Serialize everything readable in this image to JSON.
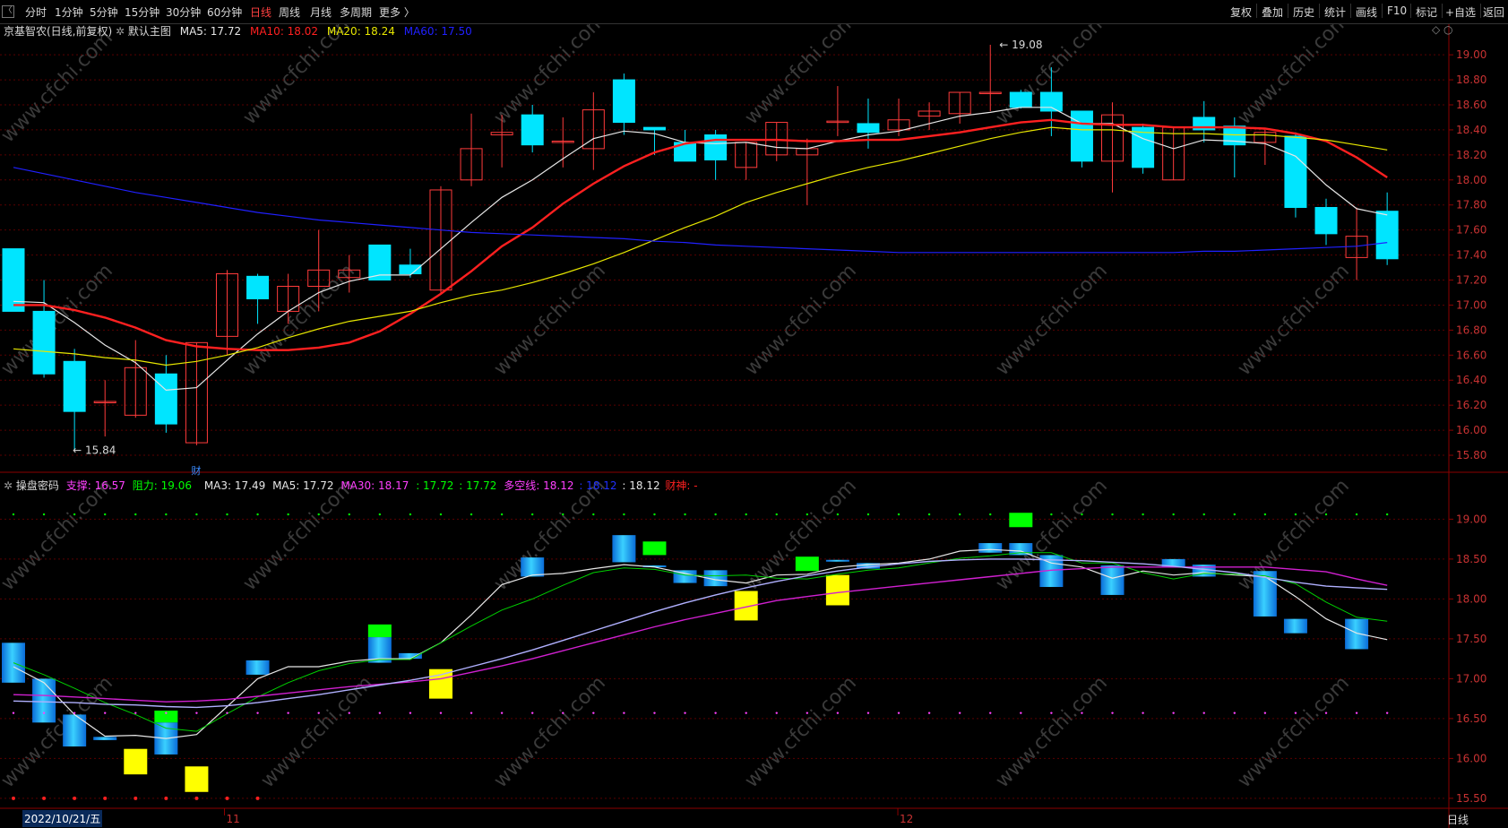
{
  "toolbar": {
    "timeframes": [
      "分时",
      "1分钟",
      "5分钟",
      "15分钟",
      "30分钟",
      "60分钟",
      "日线",
      "周线",
      "月线",
      "多周期",
      "更多 〉"
    ],
    "active": "日线",
    "right_buttons": [
      "复权",
      "叠加",
      "历史",
      "统计",
      "画线",
      "F10",
      "标记",
      "+自选",
      "返回"
    ]
  },
  "main_legend": {
    "stock": "京基智农(日线,前复权)",
    "template": "默认主图",
    "ma5": "MA5: 17.72",
    "ma10": "MA10: 18.02",
    "ma20": "MA20: 18.24",
    "ma60": "MA60: 17.50"
  },
  "sub_legend": {
    "name": "操盘密码",
    "support": "支撑: 16.57",
    "resist": "阻力: 19.06",
    "ma3": "MA3: 17.49",
    "ma5": "MA5: 17.72",
    "ma30": "MA30: 18.17",
    "v1": ": 17.72",
    "v2": ": 17.72",
    "dk": "多空线: 18.12",
    "v3": ": 18.12",
    "v4": ": 18.12",
    "caishen": "财神: -"
  },
  "annotations": {
    "high": "19.08",
    "low": "15.84",
    "fin_marker": "财"
  },
  "date_tag": "2022/10/21/五",
  "bottom_label": "日线",
  "watermark": "www.cfchi.com",
  "colors": {
    "up": "#ff3b3b",
    "down": "#00e5ff",
    "ma5": "#e6e6e6",
    "ma10": "#ff2020",
    "ma20": "#e6e600",
    "ma60": "#2020ff",
    "dk": "#c000c0",
    "green": "#00ff00",
    "yellow": "#ffff00"
  },
  "chart_data": [
    {
      "type": "candlestick",
      "title": "京基智农(日线,前复权)",
      "y_ticks": [
        15.8,
        16.0,
        16.2,
        16.4,
        16.6,
        16.8,
        17.0,
        17.2,
        17.4,
        17.6,
        17.8,
        18.0,
        18.2,
        18.4,
        18.6,
        18.8,
        19.0
      ],
      "ylim": [
        15.7,
        19.18
      ],
      "x_labels": [
        "11",
        "12"
      ],
      "candles": [
        {
          "o": 17.45,
          "h": 17.45,
          "l": 16.95,
          "c": 16.95
        },
        {
          "o": 16.95,
          "h": 17.2,
          "l": 16.42,
          "c": 16.45
        },
        {
          "o": 16.55,
          "h": 16.65,
          "l": 15.84,
          "c": 16.15
        },
        {
          "o": 16.23,
          "h": 16.4,
          "l": 15.95,
          "c": 16.23
        },
        {
          "o": 16.12,
          "h": 16.72,
          "l": 16.1,
          "c": 16.5
        },
        {
          "o": 16.45,
          "h": 16.6,
          "l": 15.98,
          "c": 16.05
        },
        {
          "o": 15.9,
          "h": 16.7,
          "l": 15.88,
          "c": 16.7
        },
        {
          "o": 16.75,
          "h": 17.28,
          "l": 16.6,
          "c": 17.25
        },
        {
          "o": 17.23,
          "h": 17.25,
          "l": 16.85,
          "c": 17.05
        },
        {
          "o": 16.95,
          "h": 17.25,
          "l": 16.85,
          "c": 17.15
        },
        {
          "o": 17.15,
          "h": 17.6,
          "l": 16.95,
          "c": 17.28
        },
        {
          "o": 17.22,
          "h": 17.4,
          "l": 17.1,
          "c": 17.28
        },
        {
          "o": 17.48,
          "h": 17.48,
          "l": 17.2,
          "c": 17.2
        },
        {
          "o": 17.32,
          "h": 17.45,
          "l": 17.22,
          "c": 17.25
        },
        {
          "o": 17.12,
          "h": 17.95,
          "l": 17.1,
          "c": 17.92
        },
        {
          "o": 18.0,
          "h": 18.53,
          "l": 17.95,
          "c": 18.25
        },
        {
          "o": 18.36,
          "h": 18.52,
          "l": 18.1,
          "c": 18.38
        },
        {
          "o": 18.52,
          "h": 18.6,
          "l": 18.22,
          "c": 18.28
        },
        {
          "o": 18.31,
          "h": 18.5,
          "l": 18.1,
          "c": 18.31
        },
        {
          "o": 18.25,
          "h": 18.7,
          "l": 18.08,
          "c": 18.56
        },
        {
          "o": 18.8,
          "h": 18.85,
          "l": 18.36,
          "c": 18.46
        },
        {
          "o": 18.42,
          "h": 18.42,
          "l": 18.2,
          "c": 18.4
        },
        {
          "o": 18.3,
          "h": 18.4,
          "l": 18.15,
          "c": 18.15
        },
        {
          "o": 18.36,
          "h": 18.4,
          "l": 18.0,
          "c": 18.16
        },
        {
          "o": 18.1,
          "h": 18.3,
          "l": 18.0,
          "c": 18.3
        },
        {
          "o": 18.2,
          "h": 18.46,
          "l": 18.15,
          "c": 18.46
        },
        {
          "o": 18.2,
          "h": 18.33,
          "l": 17.8,
          "c": 18.25
        },
        {
          "o": 18.47,
          "h": 18.75,
          "l": 18.35,
          "c": 18.47
        },
        {
          "o": 18.45,
          "h": 18.65,
          "l": 18.25,
          "c": 18.38
        },
        {
          "o": 18.4,
          "h": 18.65,
          "l": 18.35,
          "c": 18.48
        },
        {
          "o": 18.51,
          "h": 18.62,
          "l": 18.4,
          "c": 18.55
        },
        {
          "o": 18.53,
          "h": 18.7,
          "l": 18.45,
          "c": 18.7
        },
        {
          "o": 18.7,
          "h": 19.08,
          "l": 18.55,
          "c": 18.7
        },
        {
          "o": 18.7,
          "h": 18.72,
          "l": 18.57,
          "c": 18.58
        },
        {
          "o": 18.7,
          "h": 18.9,
          "l": 18.35,
          "c": 18.55
        },
        {
          "o": 18.55,
          "h": 18.55,
          "l": 18.1,
          "c": 18.15
        },
        {
          "o": 18.15,
          "h": 18.62,
          "l": 17.9,
          "c": 18.52
        },
        {
          "o": 18.42,
          "h": 18.45,
          "l": 18.05,
          "c": 18.1
        },
        {
          "o": 18.0,
          "h": 18.42,
          "l": 18.0,
          "c": 18.42
        },
        {
          "o": 18.5,
          "h": 18.63,
          "l": 18.3,
          "c": 18.4
        },
        {
          "o": 18.43,
          "h": 18.5,
          "l": 18.02,
          "c": 18.28
        },
        {
          "o": 18.3,
          "h": 18.4,
          "l": 18.12,
          "c": 18.38
        },
        {
          "o": 18.35,
          "h": 18.38,
          "l": 17.7,
          "c": 17.78
        },
        {
          "o": 17.78,
          "h": 17.85,
          "l": 17.48,
          "c": 17.57
        },
        {
          "o": 17.38,
          "h": 17.78,
          "l": 17.2,
          "c": 17.55
        },
        {
          "o": 17.75,
          "h": 17.9,
          "l": 17.32,
          "c": 17.37
        }
      ],
      "series": [
        {
          "name": "MA5",
          "values": [
            17.03,
            17.02,
            16.86,
            16.68,
            16.54,
            16.32,
            16.34,
            16.56,
            16.77,
            16.95,
            17.1,
            17.19,
            17.24,
            17.24,
            17.45,
            17.66,
            17.86,
            18.0,
            18.17,
            18.33,
            18.39,
            18.37,
            18.3,
            18.29,
            18.3,
            18.26,
            18.25,
            18.31,
            18.36,
            18.39,
            18.45,
            18.51,
            18.54,
            18.58,
            18.58,
            18.45,
            18.45,
            18.33,
            18.25,
            18.32,
            18.31,
            18.29,
            18.19,
            17.96,
            17.77,
            17.72
          ]
        },
        {
          "name": "MA10",
          "values": [
            17.0,
            17.0,
            16.96,
            16.9,
            16.82,
            16.72,
            16.67,
            16.65,
            16.64,
            16.64,
            16.66,
            16.7,
            16.79,
            16.93,
            17.09,
            17.27,
            17.47,
            17.62,
            17.81,
            17.97,
            18.11,
            18.22,
            18.29,
            18.32,
            18.32,
            18.32,
            18.31,
            18.31,
            18.32,
            18.32,
            18.35,
            18.38,
            18.42,
            18.46,
            18.48,
            18.45,
            18.44,
            18.44,
            18.42,
            18.42,
            18.42,
            18.41,
            18.37,
            18.31,
            18.18,
            18.02
          ]
        },
        {
          "name": "MA20",
          "values": [
            16.65,
            16.63,
            16.61,
            16.58,
            16.56,
            16.52,
            16.55,
            16.6,
            16.66,
            16.74,
            16.81,
            16.87,
            16.91,
            16.95,
            17.02,
            17.08,
            17.12,
            17.18,
            17.25,
            17.33,
            17.42,
            17.52,
            17.62,
            17.71,
            17.82,
            17.9,
            17.97,
            18.04,
            18.1,
            18.15,
            18.21,
            18.27,
            18.33,
            18.38,
            18.42,
            18.4,
            18.4,
            18.38,
            18.37,
            18.37,
            18.36,
            18.36,
            18.34,
            18.32,
            18.28,
            18.24
          ]
        },
        {
          "name": "MA60",
          "values": [
            18.1,
            18.05,
            18.0,
            17.95,
            17.9,
            17.86,
            17.82,
            17.78,
            17.74,
            17.71,
            17.68,
            17.66,
            17.64,
            17.62,
            17.6,
            17.58,
            17.57,
            17.56,
            17.55,
            17.54,
            17.53,
            17.51,
            17.5,
            17.48,
            17.47,
            17.46,
            17.45,
            17.44,
            17.43,
            17.42,
            17.42,
            17.42,
            17.42,
            17.42,
            17.42,
            17.42,
            17.42,
            17.42,
            17.42,
            17.43,
            17.43,
            17.44,
            17.45,
            17.46,
            17.47,
            17.5
          ]
        }
      ]
    },
    {
      "type": "bar",
      "title": "操盘密码",
      "y_ticks": [
        15.5,
        16.0,
        16.5,
        17.0,
        17.5,
        18.0,
        18.5,
        19.0
      ],
      "ylim": [
        15.42,
        19.33
      ],
      "blocks": [
        {
          "i": 0,
          "top": 17.45,
          "bot": 16.95,
          "c": "blue"
        },
        {
          "i": 1,
          "top": 17.0,
          "bot": 16.45,
          "c": "blue"
        },
        {
          "i": 2,
          "top": 16.55,
          "bot": 16.15,
          "c": "blue"
        },
        {
          "i": 3,
          "top": 16.27,
          "bot": 16.23,
          "c": "blue"
        },
        {
          "i": 4,
          "top": 16.12,
          "bot": 15.8,
          "c": "yellow"
        },
        {
          "i": 5,
          "top": 16.6,
          "bot": 16.45,
          "c": "green"
        },
        {
          "i": 5,
          "top": 16.45,
          "bot": 16.05,
          "c": "blue"
        },
        {
          "i": 6,
          "top": 15.9,
          "bot": 15.58,
          "c": "yellow"
        },
        {
          "i": 8,
          "top": 17.23,
          "bot": 17.05,
          "c": "blue"
        },
        {
          "i": 12,
          "top": 17.68,
          "bot": 17.52,
          "c": "green"
        },
        {
          "i": 12,
          "top": 17.52,
          "bot": 17.2,
          "c": "blue"
        },
        {
          "i": 13,
          "top": 17.32,
          "bot": 17.25,
          "c": "blue"
        },
        {
          "i": 14,
          "top": 17.12,
          "bot": 16.75,
          "c": "yellow"
        },
        {
          "i": 17,
          "top": 18.52,
          "bot": 18.28,
          "c": "blue"
        },
        {
          "i": 20,
          "top": 18.8,
          "bot": 18.46,
          "c": "blue"
        },
        {
          "i": 21,
          "top": 18.72,
          "bot": 18.55,
          "c": "green"
        },
        {
          "i": 21,
          "top": 18.42,
          "bot": 18.4,
          "c": "blue"
        },
        {
          "i": 22,
          "top": 18.36,
          "bot": 18.2,
          "c": "blue"
        },
        {
          "i": 23,
          "top": 18.36,
          "bot": 18.16,
          "c": "blue"
        },
        {
          "i": 24,
          "top": 18.1,
          "bot": 17.73,
          "c": "yellow"
        },
        {
          "i": 26,
          "top": 18.53,
          "bot": 18.35,
          "c": "green"
        },
        {
          "i": 27,
          "top": 18.49,
          "bot": 18.47,
          "c": "blue"
        },
        {
          "i": 27,
          "top": 18.3,
          "bot": 17.92,
          "c": "yellow"
        },
        {
          "i": 28,
          "top": 18.45,
          "bot": 18.38,
          "c": "blue"
        },
        {
          "i": 32,
          "top": 18.7,
          "bot": 18.58,
          "c": "blue"
        },
        {
          "i": 33,
          "top": 18.7,
          "bot": 18.55,
          "c": "blue"
        },
        {
          "i": 33,
          "top": 19.08,
          "bot": 18.9,
          "c": "green"
        },
        {
          "i": 34,
          "top": 18.55,
          "bot": 18.15,
          "c": "blue"
        },
        {
          "i": 36,
          "top": 18.42,
          "bot": 18.05,
          "c": "blue"
        },
        {
          "i": 38,
          "top": 18.5,
          "bot": 18.4,
          "c": "blue"
        },
        {
          "i": 39,
          "top": 18.43,
          "bot": 18.28,
          "c": "blue"
        },
        {
          "i": 41,
          "top": 18.35,
          "bot": 17.78,
          "c": "blue"
        },
        {
          "i": 42,
          "top": 17.75,
          "bot": 17.57,
          "c": "blue"
        },
        {
          "i": 44,
          "top": 17.75,
          "bot": 17.37,
          "c": "blue"
        }
      ],
      "series": [
        {
          "name": "MA3",
          "values": [
            17.15,
            16.95,
            16.55,
            16.28,
            16.29,
            16.25,
            16.3,
            16.65,
            17.0,
            17.15,
            17.15,
            17.22,
            17.25,
            17.25,
            17.45,
            17.8,
            18.18,
            18.3,
            18.32,
            18.38,
            18.43,
            18.4,
            18.32,
            18.24,
            18.2,
            18.3,
            18.31,
            18.4,
            18.43,
            18.45,
            18.5,
            18.6,
            18.62,
            18.6,
            18.45,
            18.4,
            18.26,
            18.35,
            18.3,
            18.33,
            18.3,
            18.28,
            18.03,
            17.75,
            17.57,
            17.49
          ]
        },
        {
          "name": "MA5",
          "values": [
            17.2,
            17.05,
            16.88,
            16.7,
            16.55,
            16.38,
            16.34,
            16.56,
            16.77,
            16.95,
            17.1,
            17.19,
            17.24,
            17.24,
            17.45,
            17.66,
            17.86,
            18.0,
            18.17,
            18.33,
            18.39,
            18.37,
            18.3,
            18.29,
            18.3,
            18.26,
            18.25,
            18.31,
            18.36,
            18.39,
            18.45,
            18.51,
            18.54,
            18.58,
            18.58,
            18.45,
            18.45,
            18.33,
            18.25,
            18.32,
            18.31,
            18.29,
            18.19,
            17.96,
            17.77,
            17.72
          ]
        },
        {
          "name": "MA30",
          "values": [
            16.8,
            16.79,
            16.77,
            16.75,
            16.73,
            16.71,
            16.72,
            16.74,
            16.78,
            16.82,
            16.86,
            16.9,
            16.93,
            16.96,
            17.0,
            17.08,
            17.16,
            17.25,
            17.35,
            17.45,
            17.55,
            17.65,
            17.74,
            17.82,
            17.9,
            17.98,
            18.03,
            18.08,
            18.12,
            18.16,
            18.2,
            18.24,
            18.28,
            18.32,
            18.36,
            18.38,
            18.4,
            18.4,
            18.4,
            18.4,
            18.4,
            18.4,
            18.37,
            18.34,
            18.25,
            18.17
          ]
        },
        {
          "name": "多空线",
          "values": [
            16.72,
            16.71,
            16.7,
            16.68,
            16.67,
            16.65,
            16.64,
            16.66,
            16.7,
            16.75,
            16.8,
            16.86,
            16.92,
            16.98,
            17.05,
            17.15,
            17.25,
            17.36,
            17.48,
            17.6,
            17.72,
            17.84,
            17.95,
            18.05,
            18.14,
            18.22,
            18.29,
            18.35,
            18.4,
            18.44,
            18.47,
            18.49,
            18.5,
            18.5,
            18.49,
            18.48,
            18.46,
            18.44,
            18.41,
            18.37,
            18.33,
            18.27,
            18.21,
            18.16,
            18.14,
            18.12
          ]
        }
      ],
      "dot_levels": [
        19.06,
        16.57
      ],
      "red_dot_level": 15.5
    }
  ]
}
